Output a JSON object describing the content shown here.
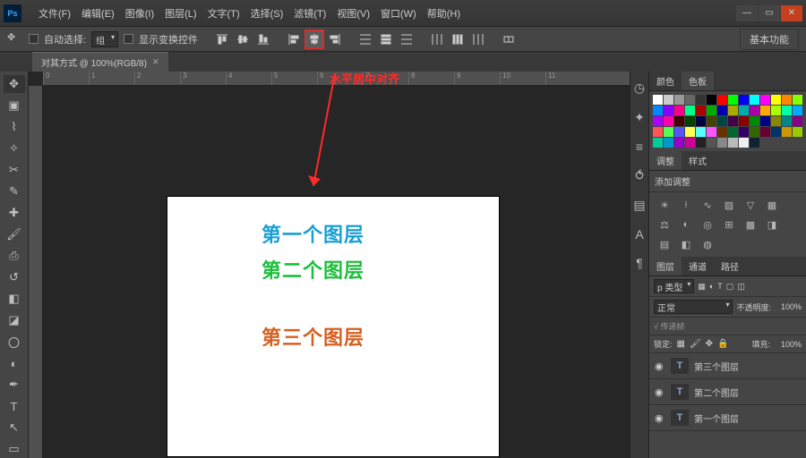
{
  "menu": {
    "file": "文件(F)",
    "edit": "编辑(E)",
    "image": "图像(I)",
    "layer": "图层(L)",
    "type": "文字(T)",
    "select": "选择(S)",
    "filter": "滤镜(T)",
    "view": "视图(V)",
    "window": "窗口(W)",
    "help": "帮助(H)"
  },
  "options": {
    "auto": "自动选择:",
    "group": "组",
    "show": "显示变换控件",
    "essentials": "基本功能"
  },
  "tab": {
    "title": "对其方式 @ 100%(RGB/8)"
  },
  "callout": "水平居中对齐",
  "canvas": {
    "t1": "第一个图层",
    "t2": "第二个图层",
    "t3": "第三个图层"
  },
  "ruler": [
    "0",
    "1",
    "2",
    "3",
    "4",
    "5",
    "6",
    "7",
    "8",
    "9",
    "10",
    "11"
  ],
  "panels": {
    "color": "颜色",
    "swatches": "色板",
    "adjust": "调整",
    "styles": "样式",
    "addAdjust": "添加调整",
    "layers": "图层",
    "channels": "通道",
    "paths": "路径",
    "kind": "p 类型",
    "normal": "正常",
    "opacity": "不透明度:",
    "opVal": "100%",
    "linkOff": "√ 传递帧",
    "lock": "锁定:",
    "fill": "填充:",
    "fillVal": "100%",
    "layer3": "第三个图层",
    "layer2": "第二个图层",
    "layer1": "第一个图层"
  }
}
